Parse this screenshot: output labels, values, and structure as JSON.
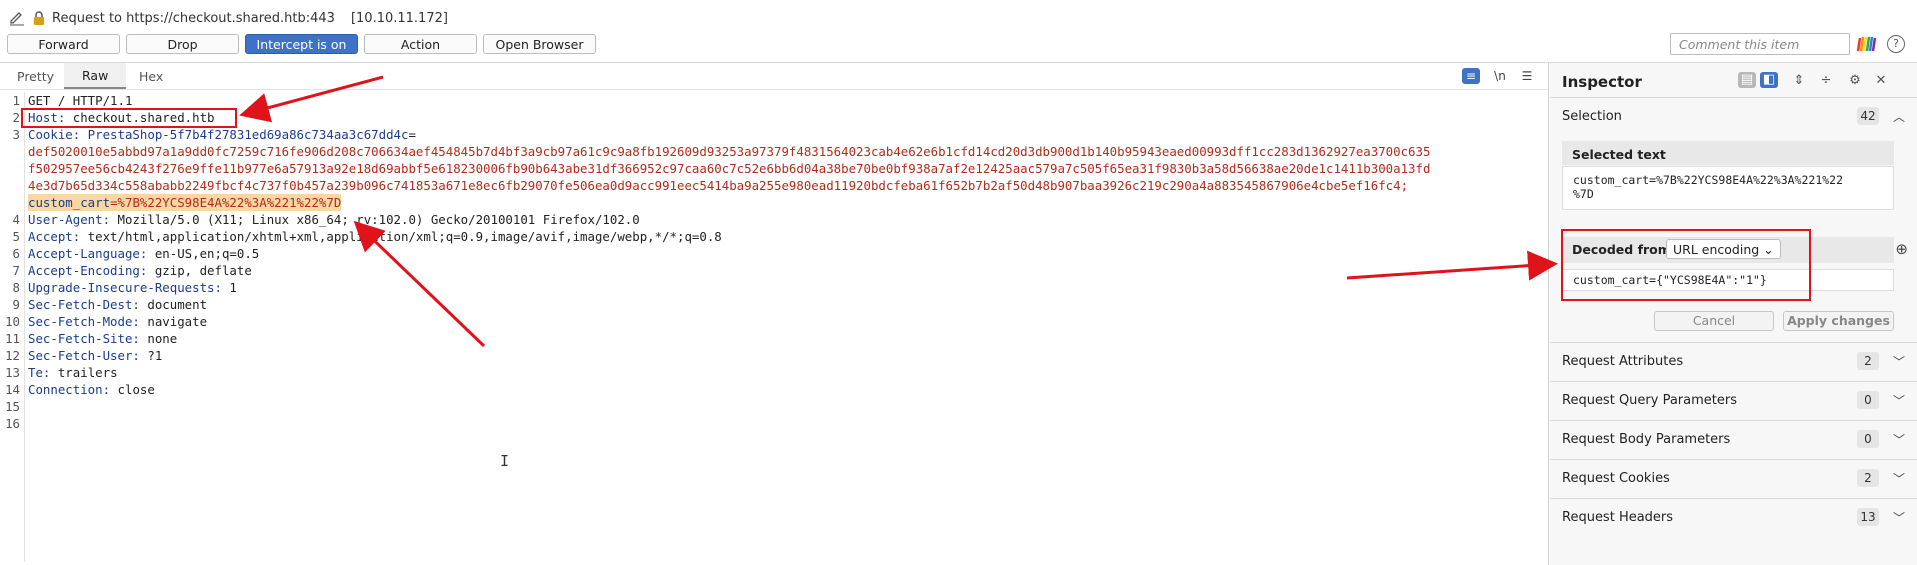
{
  "header": {
    "request_label": "Request to https://checkout.shared.htb:443",
    "ip": "[10.10.11.172]"
  },
  "toolbar": {
    "forward": "Forward",
    "drop": "Drop",
    "intercept": "Intercept is on",
    "action": "Action",
    "open_browser": "Open Browser",
    "comment_placeholder": "Comment this item"
  },
  "editor": {
    "tabs": [
      "Pretty",
      "Raw",
      "Hex"
    ],
    "active_tab": "Raw",
    "newline_toggle": "\\n",
    "lines": [
      {
        "n": "1",
        "key": "",
        "val": "GET / HTTP/1.1"
      },
      {
        "n": "2",
        "key": "Host:",
        "val": " checkout.shared.htb"
      },
      {
        "n": "3",
        "key": "Cookie:",
        "val": ""
      },
      {
        "n": "4",
        "key": "User-Agent:",
        "val": " Mozilla/5.0 (X11; Linux x86_64; rv:102.0) Gecko/20100101 Firefox/102.0"
      },
      {
        "n": "5",
        "key": "Accept:",
        "val": " text/html,application/xhtml+xml,application/xml;q=0.9,image/avif,image/webp,*/*;q=0.8"
      },
      {
        "n": "6",
        "key": "Accept-Language:",
        "val": " en-US,en;q=0.5"
      },
      {
        "n": "7",
        "key": "Accept-Encoding:",
        "val": " gzip, deflate"
      },
      {
        "n": "8",
        "key": "Upgrade-Insecure-Requests:",
        "val": " 1"
      },
      {
        "n": "9",
        "key": "Sec-Fetch-Dest:",
        "val": " document"
      },
      {
        "n": "10",
        "key": "Sec-Fetch-Mode:",
        "val": " navigate"
      },
      {
        "n": "11",
        "key": "Sec-Fetch-Site:",
        "val": " none"
      },
      {
        "n": "12",
        "key": "Sec-Fetch-User:",
        "val": " ?1"
      },
      {
        "n": "13",
        "key": "Te:",
        "val": " trailers"
      },
      {
        "n": "14",
        "key": "Connection:",
        "val": " close"
      },
      {
        "n": "15",
        "key": "",
        "val": ""
      },
      {
        "n": "16",
        "key": "",
        "val": ""
      }
    ],
    "cookie": {
      "name1": " PrestaShop-5f7b4f27831ed69a86c734aa3c67dd4c",
      "eq": "=",
      "wrap1": "def5020010e5abbd97a1a9dd0fc7259c716fe906d208c706634aef454845b7d4bf3a9cb97a61c9c9a8fb192609d93253a97379f4831564023cab4e62e6b1cfd14cd20d3db900d1b140b95943eaed00993dff1cc283d1362927ea3700c635",
      "wrap2": "f502957ee56cb4243f276e9ffe11b977e6a57913a92e18d69abbf5e618230006fb90b643abe31df366952c97caa60c7c52e6bb6d04a38be70be0bf938a7af2e12425aac579a7c505f65ea31f9830b3a58d56638ae20de1c1411b300a13fd",
      "wrap3": "4e3d7b65d334c558ababb2249fbcf4c737f0b457a239b096c741853a671e8ec6fb29070fe506ea0d9acc991eec5414ba9a255e980ead11920bdcfeba61f652b7b2af50d48b907baa3926c219c290a4a883545867906e4cbe5ef16fc4;",
      "cart_name": "custom_cart",
      "cart_value": "=%7B%22YCS98E4A%22%3A%221%22%7D"
    }
  },
  "inspector": {
    "title": "Inspector",
    "selection_label": "Selection",
    "selection_count": "42",
    "selected_text_label": "Selected text",
    "selected_text_line1": "custom_cart=%7B%22YCS98E4A%22%3A%221%22",
    "selected_text_line2": "%7D",
    "decoded_from_label": "Decoded from:",
    "decoded_from_value": "URL encoding",
    "decoded_value": "custom_cart={\"YCS98E4A\":\"1\"}",
    "cancel": "Cancel",
    "apply": "Apply changes",
    "sections": [
      {
        "label": "Request Attributes",
        "count": "2"
      },
      {
        "label": "Request Query Parameters",
        "count": "0"
      },
      {
        "label": "Request Body Parameters",
        "count": "0"
      },
      {
        "label": "Request Cookies",
        "count": "2"
      },
      {
        "label": "Request Headers",
        "count": "13"
      }
    ]
  },
  "colors": {
    "accent": "#3d72c8",
    "annotation_red": "#e0131a",
    "cookie_value": "#b22b1c",
    "header_key": "#1a3d8f",
    "highlight": "#fad7a0"
  }
}
